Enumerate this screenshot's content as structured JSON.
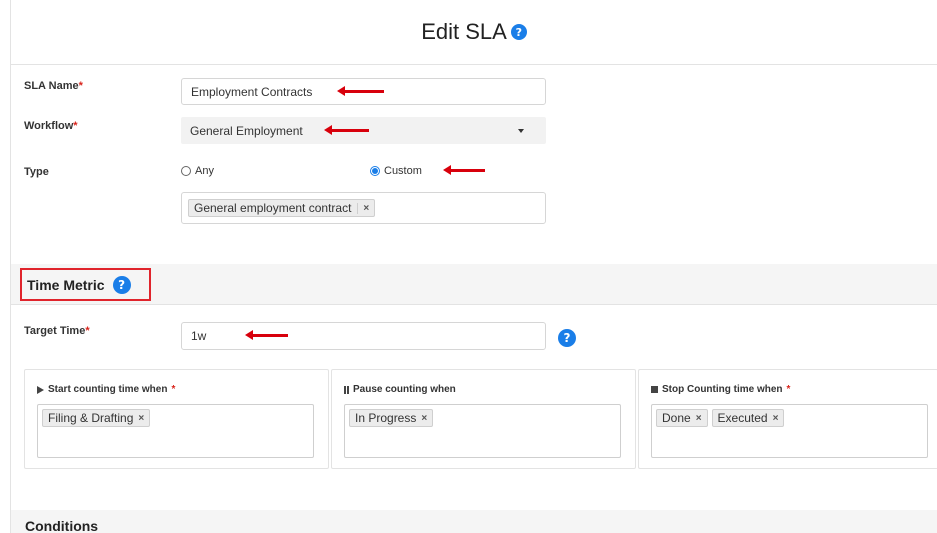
{
  "header": {
    "title": "Edit SLA",
    "help_icon": "?"
  },
  "form": {
    "sla_name": {
      "label": "SLA Name",
      "required_mark": "*",
      "value": "Employment Contracts"
    },
    "workflow": {
      "label": "Workflow",
      "required_mark": "*",
      "value": "General Employment"
    },
    "type": {
      "label": "Type",
      "options": [
        {
          "label": "Any",
          "selected": false
        },
        {
          "label": "Custom",
          "selected": true
        }
      ],
      "tags": [
        {
          "label": "General employment contract",
          "remove": "×"
        }
      ]
    }
  },
  "time_metric": {
    "title": "Time Metric",
    "help_icon": "?",
    "target_time": {
      "label": "Target Time",
      "required_mark": "*",
      "value": "1w"
    },
    "start": {
      "label": "Start counting time when",
      "required_mark": "*",
      "tags": [
        "Filing & Drafting"
      ]
    },
    "pause": {
      "label": "Pause counting when",
      "tags": [
        "In Progress"
      ]
    },
    "stop": {
      "label": "Stop Counting time when",
      "required_mark": "*",
      "tags": [
        "Done",
        "Executed"
      ]
    },
    "tag_remove": "×"
  },
  "conditions": {
    "title": "Conditions"
  },
  "annotation_color": "#d8000c",
  "accent_color": "#1a7ee8"
}
